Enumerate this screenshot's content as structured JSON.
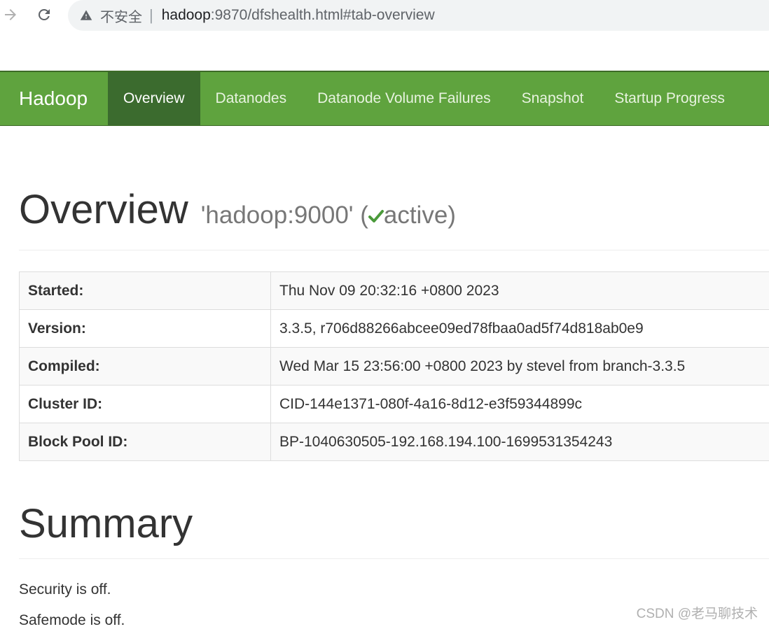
{
  "browser": {
    "insecure_label": "不安全",
    "separator": "|",
    "url_host": "hadoop",
    "url_rest": ":9870/dfshealth.html#tab-overview"
  },
  "navbar": {
    "brand": "Hadoop",
    "items": [
      {
        "label": "Overview",
        "active": true
      },
      {
        "label": "Datanodes",
        "active": false
      },
      {
        "label": "Datanode Volume Failures",
        "active": false
      },
      {
        "label": "Snapshot",
        "active": false
      },
      {
        "label": "Startup Progress",
        "active": false
      }
    ],
    "colors": {
      "background": "#5fa33e",
      "active": "#3b6b2e"
    }
  },
  "overview": {
    "title": "Overview",
    "namenode": "'hadoop:9000'",
    "state_open": "(",
    "state": "active)",
    "rows": [
      {
        "key": "Started:",
        "value": "Thu Nov 09 20:32:16 +0800 2023"
      },
      {
        "key": "Version:",
        "value": "3.3.5, r706d88266abcee09ed78fbaa0ad5f74d818ab0e9"
      },
      {
        "key": "Compiled:",
        "value": "Wed Mar 15 23:56:00 +0800 2023 by stevel from branch-3.3.5"
      },
      {
        "key": "Cluster ID:",
        "value": "CID-144e1371-080f-4a16-8d12-e3f59344899c"
      },
      {
        "key": "Block Pool ID:",
        "value": "BP-1040630505-192.168.194.100-1699531354243"
      }
    ]
  },
  "summary": {
    "title": "Summary",
    "security": "Security is off.",
    "safemode": "Safemode is off."
  },
  "watermark": "CSDN @老马聊技术"
}
